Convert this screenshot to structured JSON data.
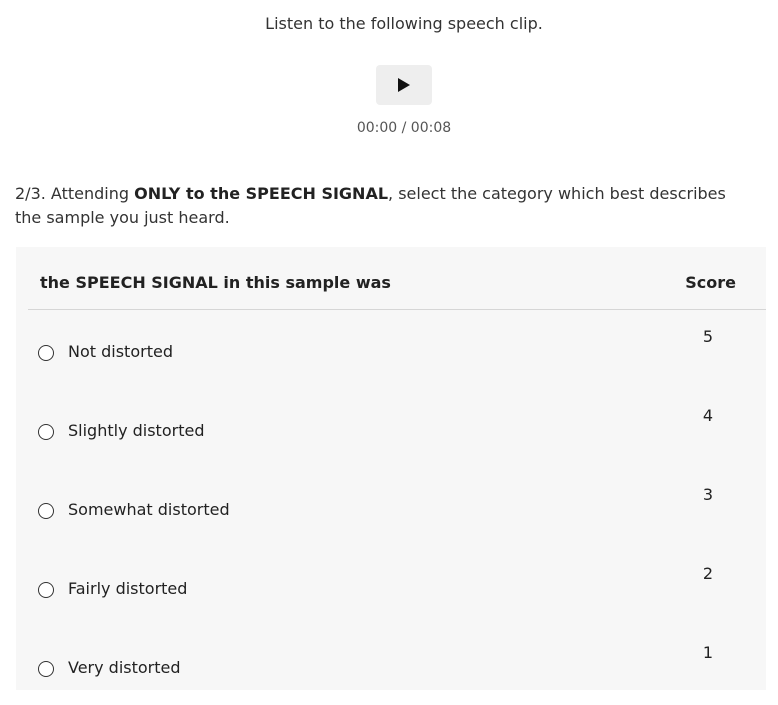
{
  "player": {
    "instruction": "Listen to the following speech clip.",
    "play_icon": "play-icon",
    "time_display": "00:00 / 00:08"
  },
  "question": {
    "prefix": "2/3. Attending ",
    "bold_text": "ONLY to the SPEECH SIGNAL",
    "suffix": ", select the category which best describes the sample you just heard."
  },
  "table": {
    "header_label": "the SPEECH SIGNAL in this sample was",
    "header_score": "Score",
    "options": [
      {
        "label": "Not distorted",
        "score": "5"
      },
      {
        "label": "Slightly distorted",
        "score": "4"
      },
      {
        "label": "Somewhat distorted",
        "score": "3"
      },
      {
        "label": "Fairly distorted",
        "score": "2"
      },
      {
        "label": "Very distorted",
        "score": "1"
      }
    ]
  }
}
